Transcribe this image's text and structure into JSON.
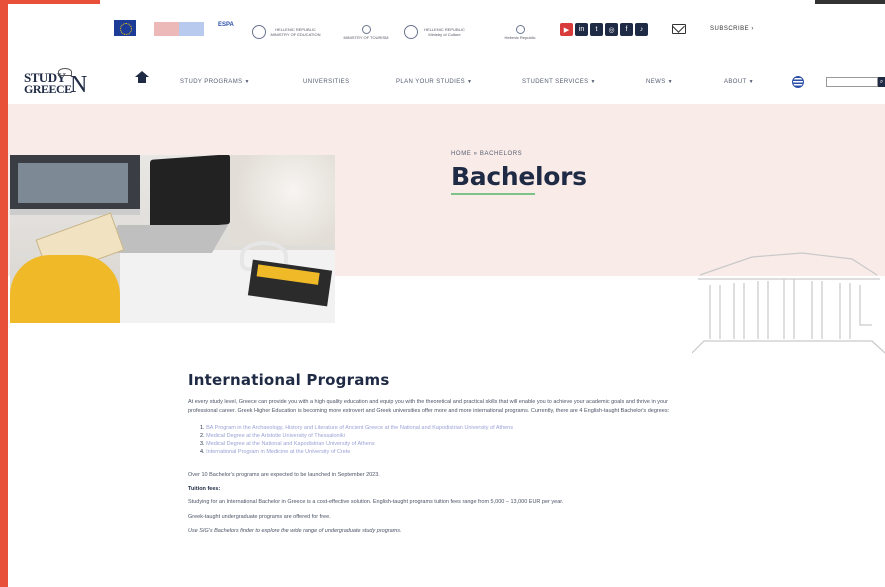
{
  "topbar": {
    "partners": [
      {
        "name": "eu-flag"
      },
      {
        "text": "ESPA"
      },
      {
        "text": "HELLENIC REPUBLIC MINISTRY OF EDUCATION"
      },
      {
        "text": "MINISTRY OF TOURISM"
      },
      {
        "text": "HELLENIC REPUBLIC Ministry of Culture"
      },
      {
        "text": "Hellenic Republic"
      }
    ],
    "social_icons": [
      "youtube-icon",
      "linkedin-icon",
      "twitter-icon",
      "instagram-icon",
      "facebook-icon",
      "tiktok-icon"
    ],
    "subscribe_label": "SUBSCRIBE"
  },
  "nav": {
    "logo_line1": "STUDY",
    "logo_line2": "GREECE",
    "logo_n": "N",
    "items": [
      {
        "label": "STUDY PROGRAMS",
        "dropdown": true
      },
      {
        "label": "UNIVERSITIES",
        "dropdown": false
      },
      {
        "label": "PLAN YOUR STUDIES",
        "dropdown": true
      },
      {
        "label": "STUDENT SERVICES",
        "dropdown": true
      },
      {
        "label": "NEWS",
        "dropdown": true
      },
      {
        "label": "ABOUT",
        "dropdown": true
      }
    ]
  },
  "hero": {
    "breadcrumb": "HOME » BACHELORS",
    "title": "Bachelors"
  },
  "content": {
    "section_title": "International Programs",
    "intro": "At every study level, Greece can provide you with a high quality education and equip you with the theoretical and practical skills that will enable you to achieve your academic goals and thrive in your professional career. Greek Higher Education is becoming more extrovert and Greek universities offer more and more international programs. Currently, there are 4 English-taught Bachelor's degrees:",
    "programs": [
      "BA Program in the Archaeology, History and Literature of Ancient Greece at the National and Kapodistrian University of Athens",
      "Medical Degree at the Aristotle University of Thessaloniki",
      "Medical Degree at the National and Kapodistrian University of Athens",
      "International Program in Medicine at the University of Crete"
    ],
    "upcoming": "Over 10 Bachelor's programs are expected to be launched in September 2023.",
    "tuition_heading": "Tuition fees:",
    "tuition_text": "Studying for an International Bachelor in Greece is a cost-effective solution. English-taught programs tuition fees range from 5,000 – 13,000 EUR per year.",
    "free_text": "Greek-taught undergraduate programs are offered for free.",
    "finder_text": "Use SIG's Bachelors finder to explore the wide range of undergraduate study programs."
  }
}
